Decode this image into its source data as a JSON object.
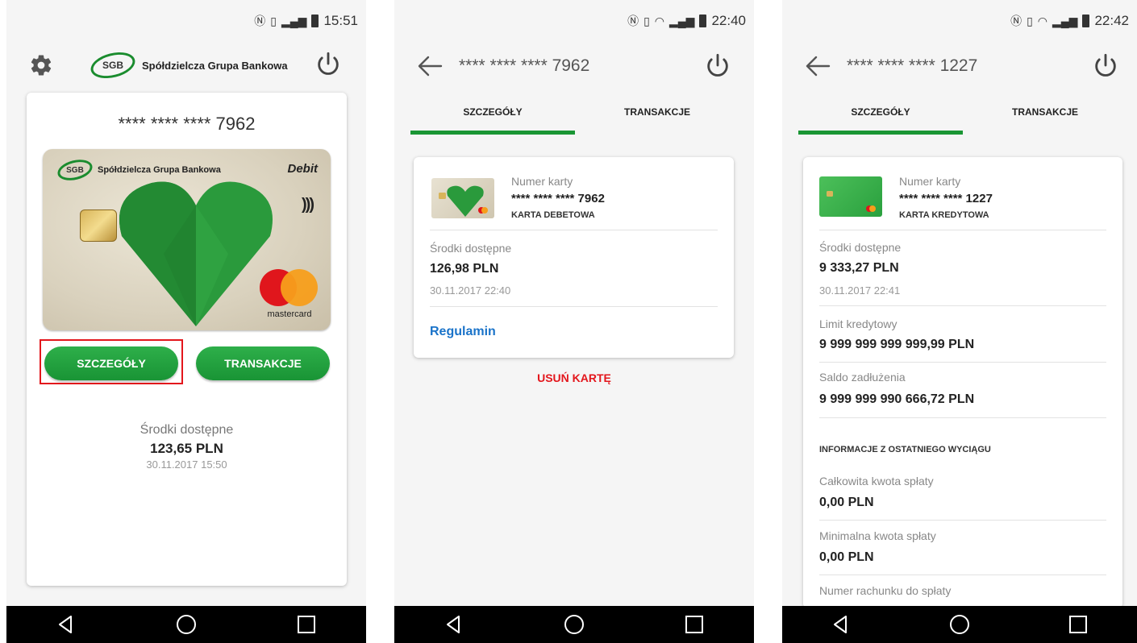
{
  "screen1": {
    "status_time": "15:51",
    "logo_abbr": "SGB",
    "logo_text": "Spółdzielcza Grupa Bankowa",
    "card_number": "**** **** **** 7962",
    "card_brand_text": "Spółdzielcza Grupa Bankowa",
    "card_type": "Debit",
    "network": "mastercard",
    "btn_details": "SZCZEGÓŁY",
    "btn_transactions": "TRANSAKCJE",
    "avail_label": "Środki dostępne",
    "avail_amount": "123,65 PLN",
    "avail_date": "30.11.2017 15:50"
  },
  "screen2": {
    "status_time": "22:40",
    "title": "**** **** **** 7962",
    "tab_details": "SZCZEGÓŁY",
    "tab_transactions": "TRANSAKCJE",
    "card_label": "Numer karty",
    "card_number": "**** **** **** 7962",
    "card_kind": "KARTA DEBETOWA",
    "avail_label": "Środki dostępne",
    "avail_amount": "126,98 PLN",
    "avail_date": "30.11.2017 22:40",
    "terms_link": "Regulamin",
    "remove_card": "USUŃ KARTĘ"
  },
  "screen3": {
    "status_time": "22:42",
    "title": "**** **** **** 1227",
    "tab_details": "SZCZEGÓŁY",
    "tab_transactions": "TRANSAKCJE",
    "card_label": "Numer karty",
    "card_number": "**** **** **** 1227",
    "card_kind": "KARTA KREDYTOWA",
    "avail_label": "Środki dostępne",
    "avail_amount": "9 333,27 PLN",
    "avail_date": "30.11.2017 22:41",
    "limit_label": "Limit kredytowy",
    "limit_value": "9 999 999 999 999,99 PLN",
    "debt_label": "Saldo zadłużenia",
    "debt_value": "9 999 999 990 666,72 PLN",
    "statement_header": "INFORMACJE Z OSTATNIEGO WYCIĄGU",
    "total_label": "Całkowita kwota spłaty",
    "total_value": "0,00 PLN",
    "min_label": "Minimalna kwota spłaty",
    "min_value": "0,00 PLN",
    "account_label": "Numer rachunku do spłaty"
  },
  "colors": {
    "brand_green": "#1a9634",
    "danger_red": "#e3161c",
    "link_blue": "#1a73c9"
  },
  "icons": [
    "nfc-icon",
    "vibrate-icon",
    "wifi-icon",
    "signal-icon",
    "battery-icon",
    "gear-icon",
    "power-icon",
    "back-arrow-icon",
    "nav-back-icon",
    "nav-home-icon",
    "nav-recents-icon"
  ]
}
